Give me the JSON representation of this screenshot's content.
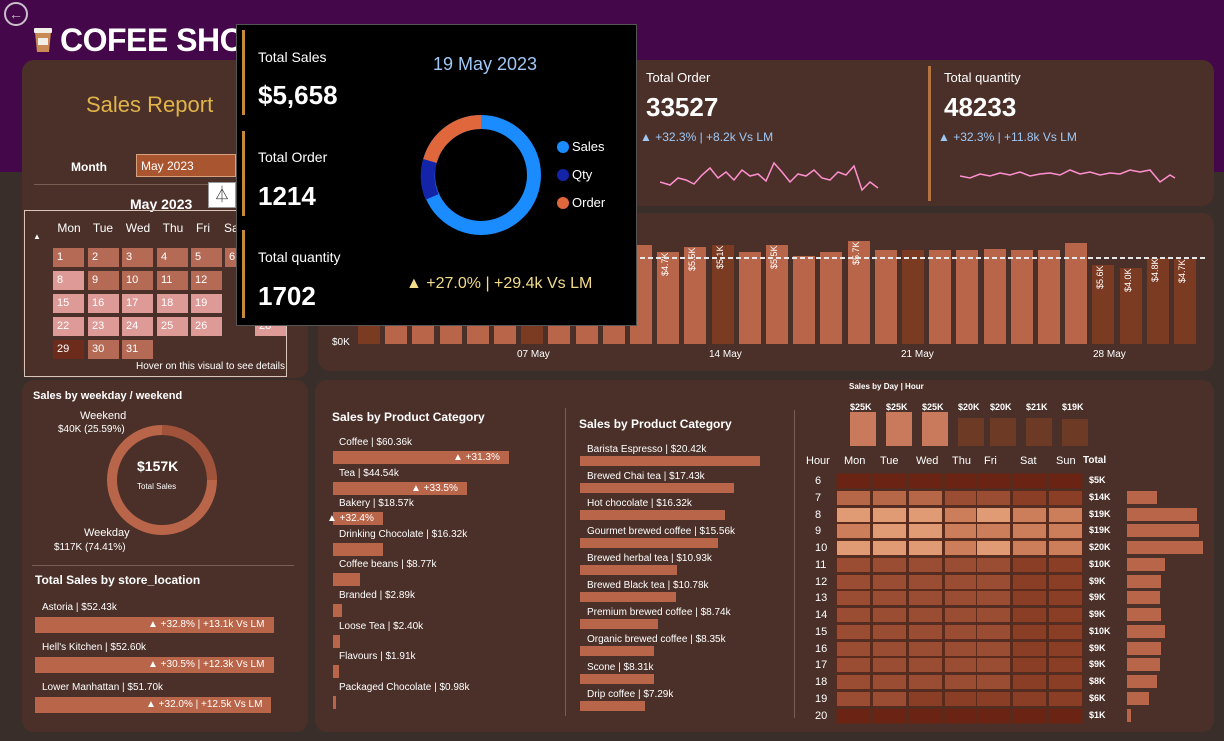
{
  "app": {
    "title": "COFEE SHOP"
  },
  "sidebar": {
    "report_title": "Sales Report",
    "month_label": "Month",
    "month_value": "May 2023",
    "calendar": {
      "title": "May 2023",
      "weekdays": [
        "Mon",
        "Tue",
        "Wed",
        "Thu",
        "Fri",
        "Sat"
      ],
      "hover_note": "Hover on this visual to see details"
    }
  },
  "weekday_weekend": {
    "title": "Sales by weekday / weekend",
    "weekend_label": "Weekend",
    "weekend_value": "$40K (25.59%)",
    "weekday_label": "Weekday",
    "weekday_value": "$117K (74.41%)",
    "center_value": "$157K",
    "center_label": "Total Sales"
  },
  "store_location": {
    "title": "Total Sales by store_location",
    "items": [
      {
        "label": "Astoria | $52.43k",
        "delta": "▲ +32.8% | +13.1k Vs LM"
      },
      {
        "label": "Hell's Kitchen | $52.60k",
        "delta": "▲ +30.5% | +12.3k Vs LM"
      },
      {
        "label": "Lower Manhattan | $51.70k",
        "delta": "▲ +32.0% | +12.5k Vs LM"
      }
    ]
  },
  "kpis": {
    "order": {
      "title": "Total Order",
      "value": "33527",
      "delta": "▲ +32.3% | +8.2k Vs LM"
    },
    "quantity": {
      "title": "Total quantity",
      "value": "48233",
      "delta": "▲ +32.3% | +11.8k Vs LM"
    }
  },
  "daily": {
    "y_label": "$0K",
    "x_labels": [
      "07 May",
      "14 May",
      "21 May",
      "28 May"
    ],
    "bar_labels": [
      "$4.7K",
      "$5.5K",
      "$5.1K",
      "$5.5K",
      "$5.7K",
      "$5.6K",
      "$4.0K",
      "$4.8K",
      "$4.7K"
    ]
  },
  "category": {
    "title": "Sales by Product Category",
    "items": [
      {
        "label": "Coffee | $60.36k",
        "delta": "▲ +31.3%"
      },
      {
        "label": "Tea | $44.54k",
        "delta": "▲ +33.5%"
      },
      {
        "label": "Bakery | $18.57k",
        "delta": "▲ +32.4%"
      },
      {
        "label": "Drinking Chocolate | $16.32k",
        "delta": ""
      },
      {
        "label": "Coffee beans | $8.77k",
        "delta": ""
      },
      {
        "label": "Branded | $2.89k",
        "delta": ""
      },
      {
        "label": "Loose Tea | $2.40k",
        "delta": ""
      },
      {
        "label": "Flavours | $1.91k",
        "delta": ""
      },
      {
        "label": "Packaged Chocolate | $0.98k",
        "delta": ""
      }
    ]
  },
  "product": {
    "title": "Sales by Product Category",
    "items": [
      {
        "label": "Barista Espresso | $20.42k"
      },
      {
        "label": "Brewed Chai tea | $17.43k"
      },
      {
        "label": "Hot chocolate | $16.32k"
      },
      {
        "label": "Gourmet brewed coffee | $15.56k"
      },
      {
        "label": "Brewed herbal tea | $10.93k"
      },
      {
        "label": "Brewed Black tea | $10.78k"
      },
      {
        "label": "Premium brewed coffee | $8.74k"
      },
      {
        "label": "Organic brewed coffee | $8.35k"
      },
      {
        "label": "Scone | $8.31k"
      },
      {
        "label": "Drip coffee | $7.29k"
      }
    ]
  },
  "heatmap": {
    "title": "Sales by Day | Hour",
    "day_totals": [
      "$25K",
      "$25K",
      "$25K",
      "$20K",
      "$20K",
      "$21K",
      "$19K"
    ],
    "hour_header": "Hour",
    "days": [
      "Mon",
      "Tue",
      "Wed",
      "Thu",
      "Fri",
      "Sat",
      "Sun"
    ],
    "total_header": "Total",
    "hours": [
      "6",
      "7",
      "8",
      "9",
      "10",
      "11",
      "12",
      "13",
      "14",
      "15",
      "16",
      "17",
      "18",
      "19",
      "20"
    ],
    "hour_totals": [
      "$5K",
      "$14K",
      "$19K",
      "$19K",
      "$20K",
      "$10K",
      "$9K",
      "$9K",
      "$9K",
      "$10K",
      "$9K",
      "$9K",
      "$8K",
      "$6K",
      "$1K"
    ]
  },
  "tooltip": {
    "date": "19 May 2023",
    "sales_title": "Total Sales",
    "sales_value": "$5,658",
    "order_title": "Total Order",
    "order_value": "1214",
    "qty_title": "Total quantity",
    "qty_value": "1702",
    "legend": [
      "Sales",
      "Qty",
      "Order"
    ],
    "delta": "▲ +27.0% | +29.4k Vs LM"
  },
  "colors": {
    "topbar": "#44084a",
    "panel": "#4a3028",
    "accent": "#b9654a",
    "gold": "#e0b44a"
  }
}
